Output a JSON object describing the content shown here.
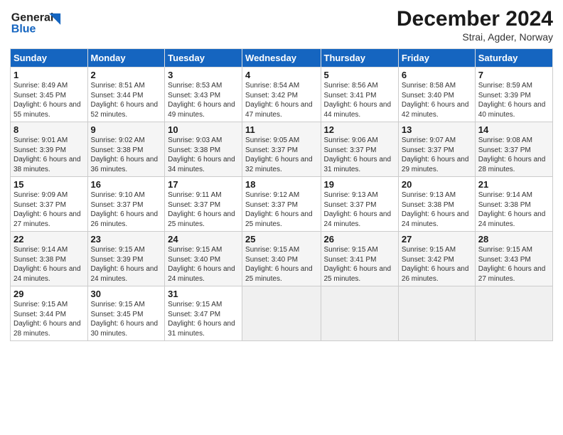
{
  "header": {
    "logo_line1": "General",
    "logo_line2": "Blue",
    "title": "December 2024",
    "subtitle": "Strai, Agder, Norway"
  },
  "calendar": {
    "days_of_week": [
      "Sunday",
      "Monday",
      "Tuesday",
      "Wednesday",
      "Thursday",
      "Friday",
      "Saturday"
    ],
    "weeks": [
      [
        {
          "num": "1",
          "sunrise": "Sunrise: 8:49 AM",
          "sunset": "Sunset: 3:45 PM",
          "daylight": "Daylight: 6 hours and 55 minutes."
        },
        {
          "num": "2",
          "sunrise": "Sunrise: 8:51 AM",
          "sunset": "Sunset: 3:44 PM",
          "daylight": "Daylight: 6 hours and 52 minutes."
        },
        {
          "num": "3",
          "sunrise": "Sunrise: 8:53 AM",
          "sunset": "Sunset: 3:43 PM",
          "daylight": "Daylight: 6 hours and 49 minutes."
        },
        {
          "num": "4",
          "sunrise": "Sunrise: 8:54 AM",
          "sunset": "Sunset: 3:42 PM",
          "daylight": "Daylight: 6 hours and 47 minutes."
        },
        {
          "num": "5",
          "sunrise": "Sunrise: 8:56 AM",
          "sunset": "Sunset: 3:41 PM",
          "daylight": "Daylight: 6 hours and 44 minutes."
        },
        {
          "num": "6",
          "sunrise": "Sunrise: 8:58 AM",
          "sunset": "Sunset: 3:40 PM",
          "daylight": "Daylight: 6 hours and 42 minutes."
        },
        {
          "num": "7",
          "sunrise": "Sunrise: 8:59 AM",
          "sunset": "Sunset: 3:39 PM",
          "daylight": "Daylight: 6 hours and 40 minutes."
        }
      ],
      [
        {
          "num": "8",
          "sunrise": "Sunrise: 9:01 AM",
          "sunset": "Sunset: 3:39 PM",
          "daylight": "Daylight: 6 hours and 38 minutes."
        },
        {
          "num": "9",
          "sunrise": "Sunrise: 9:02 AM",
          "sunset": "Sunset: 3:38 PM",
          "daylight": "Daylight: 6 hours and 36 minutes."
        },
        {
          "num": "10",
          "sunrise": "Sunrise: 9:03 AM",
          "sunset": "Sunset: 3:38 PM",
          "daylight": "Daylight: 6 hours and 34 minutes."
        },
        {
          "num": "11",
          "sunrise": "Sunrise: 9:05 AM",
          "sunset": "Sunset: 3:37 PM",
          "daylight": "Daylight: 6 hours and 32 minutes."
        },
        {
          "num": "12",
          "sunrise": "Sunrise: 9:06 AM",
          "sunset": "Sunset: 3:37 PM",
          "daylight": "Daylight: 6 hours and 31 minutes."
        },
        {
          "num": "13",
          "sunrise": "Sunrise: 9:07 AM",
          "sunset": "Sunset: 3:37 PM",
          "daylight": "Daylight: 6 hours and 29 minutes."
        },
        {
          "num": "14",
          "sunrise": "Sunrise: 9:08 AM",
          "sunset": "Sunset: 3:37 PM",
          "daylight": "Daylight: 6 hours and 28 minutes."
        }
      ],
      [
        {
          "num": "15",
          "sunrise": "Sunrise: 9:09 AM",
          "sunset": "Sunset: 3:37 PM",
          "daylight": "Daylight: 6 hours and 27 minutes."
        },
        {
          "num": "16",
          "sunrise": "Sunrise: 9:10 AM",
          "sunset": "Sunset: 3:37 PM",
          "daylight": "Daylight: 6 hours and 26 minutes."
        },
        {
          "num": "17",
          "sunrise": "Sunrise: 9:11 AM",
          "sunset": "Sunset: 3:37 PM",
          "daylight": "Daylight: 6 hours and 25 minutes."
        },
        {
          "num": "18",
          "sunrise": "Sunrise: 9:12 AM",
          "sunset": "Sunset: 3:37 PM",
          "daylight": "Daylight: 6 hours and 25 minutes."
        },
        {
          "num": "19",
          "sunrise": "Sunrise: 9:13 AM",
          "sunset": "Sunset: 3:37 PM",
          "daylight": "Daylight: 6 hours and 24 minutes."
        },
        {
          "num": "20",
          "sunrise": "Sunrise: 9:13 AM",
          "sunset": "Sunset: 3:38 PM",
          "daylight": "Daylight: 6 hours and 24 minutes."
        },
        {
          "num": "21",
          "sunrise": "Sunrise: 9:14 AM",
          "sunset": "Sunset: 3:38 PM",
          "daylight": "Daylight: 6 hours and 24 minutes."
        }
      ],
      [
        {
          "num": "22",
          "sunrise": "Sunrise: 9:14 AM",
          "sunset": "Sunset: 3:38 PM",
          "daylight": "Daylight: 6 hours and 24 minutes."
        },
        {
          "num": "23",
          "sunrise": "Sunrise: 9:15 AM",
          "sunset": "Sunset: 3:39 PM",
          "daylight": "Daylight: 6 hours and 24 minutes."
        },
        {
          "num": "24",
          "sunrise": "Sunrise: 9:15 AM",
          "sunset": "Sunset: 3:40 PM",
          "daylight": "Daylight: 6 hours and 24 minutes."
        },
        {
          "num": "25",
          "sunrise": "Sunrise: 9:15 AM",
          "sunset": "Sunset: 3:40 PM",
          "daylight": "Daylight: 6 hours and 25 minutes."
        },
        {
          "num": "26",
          "sunrise": "Sunrise: 9:15 AM",
          "sunset": "Sunset: 3:41 PM",
          "daylight": "Daylight: 6 hours and 25 minutes."
        },
        {
          "num": "27",
          "sunrise": "Sunrise: 9:15 AM",
          "sunset": "Sunset: 3:42 PM",
          "daylight": "Daylight: 6 hours and 26 minutes."
        },
        {
          "num": "28",
          "sunrise": "Sunrise: 9:15 AM",
          "sunset": "Sunset: 3:43 PM",
          "daylight": "Daylight: 6 hours and 27 minutes."
        }
      ],
      [
        {
          "num": "29",
          "sunrise": "Sunrise: 9:15 AM",
          "sunset": "Sunset: 3:44 PM",
          "daylight": "Daylight: 6 hours and 28 minutes."
        },
        {
          "num": "30",
          "sunrise": "Sunrise: 9:15 AM",
          "sunset": "Sunset: 3:45 PM",
          "daylight": "Daylight: 6 hours and 30 minutes."
        },
        {
          "num": "31",
          "sunrise": "Sunrise: 9:15 AM",
          "sunset": "Sunset: 3:47 PM",
          "daylight": "Daylight: 6 hours and 31 minutes."
        },
        null,
        null,
        null,
        null
      ]
    ]
  }
}
